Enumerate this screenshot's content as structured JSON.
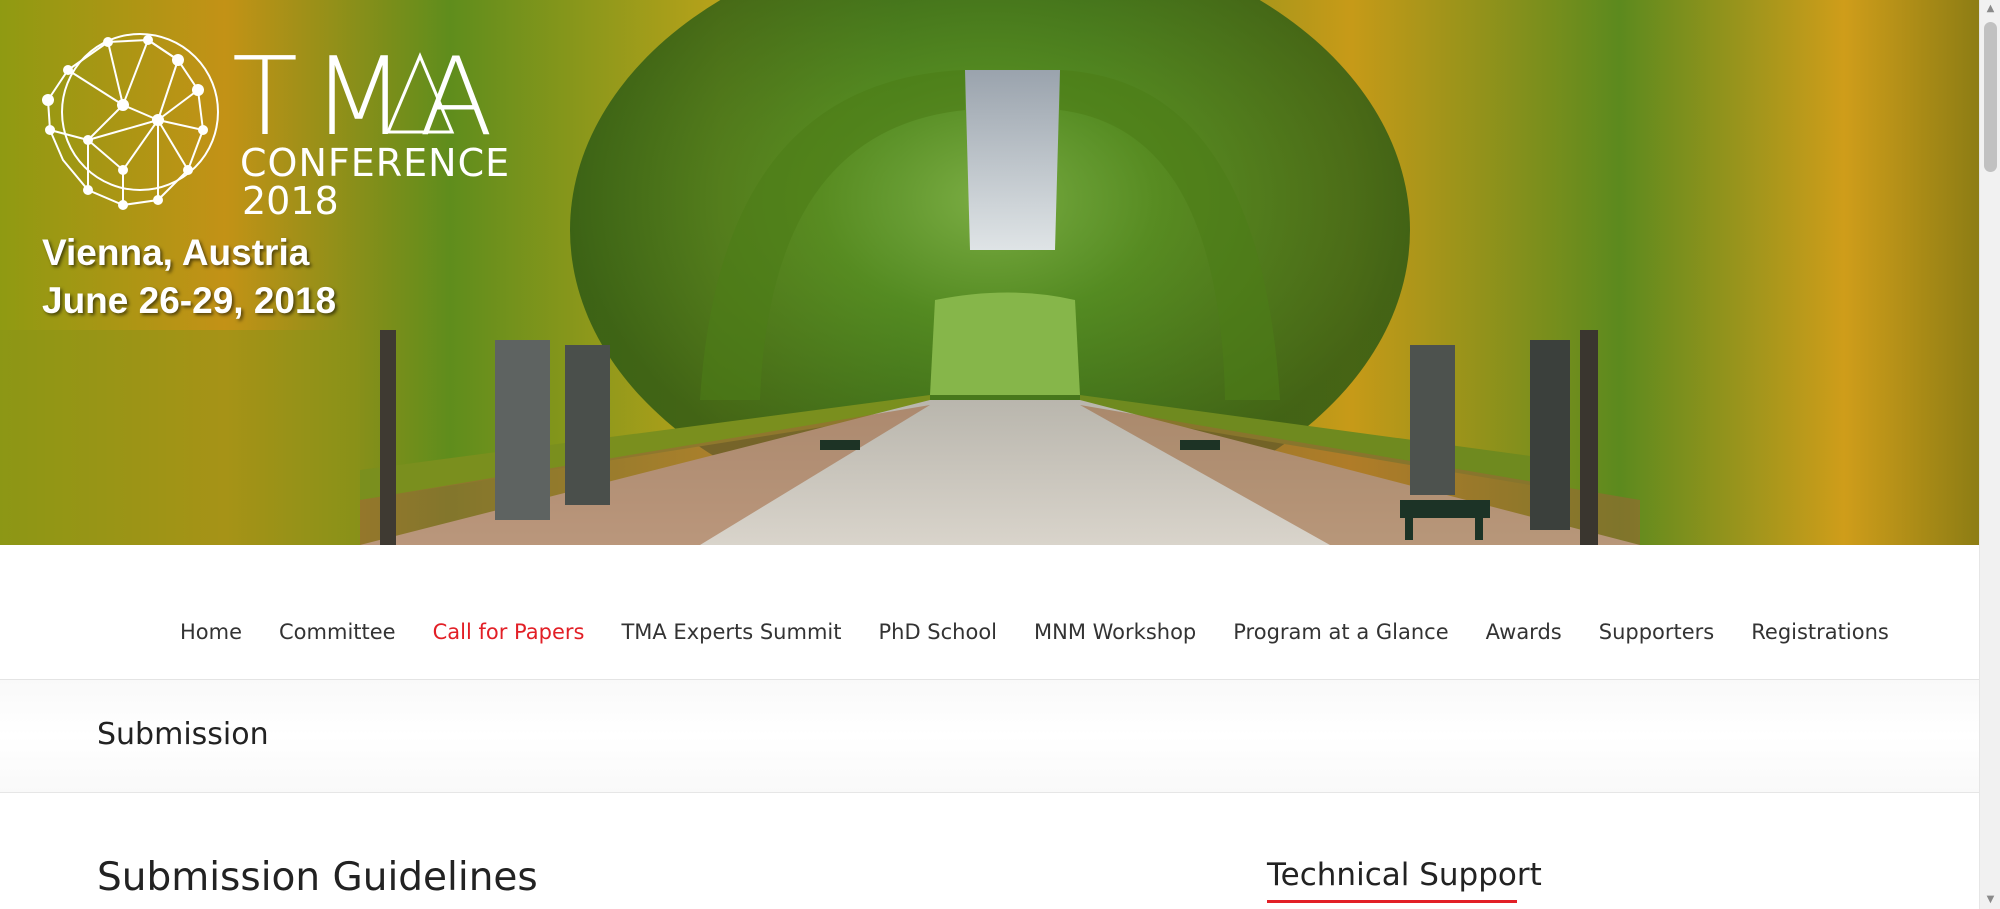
{
  "hero": {
    "logo_wordmark": "TMA",
    "logo_conference": "CONFERENCE",
    "logo_year": "2018",
    "location": "Vienna, Austria",
    "dates": "June 26-29, 2018"
  },
  "nav": {
    "items": [
      {
        "label": "Home"
      },
      {
        "label": "Committee"
      },
      {
        "label": "Call for Papers",
        "active": true
      },
      {
        "label": "TMA Experts Summit"
      },
      {
        "label": "PhD School"
      },
      {
        "label": "MNM Workshop"
      },
      {
        "label": "Program at a Glance"
      },
      {
        "label": "Awards"
      },
      {
        "label": "Supporters"
      },
      {
        "label": "Registrations"
      }
    ]
  },
  "page": {
    "title": "Submission"
  },
  "main": {
    "heading": "Submission Guidelines"
  },
  "sidebar": {
    "heading": "Technical Support"
  },
  "colors": {
    "accent": "#e21f26",
    "nav_text": "#333333"
  },
  "scrollbar": {
    "up_icon": "scroll-up-arrow",
    "down_icon": "scroll-down-arrow"
  }
}
